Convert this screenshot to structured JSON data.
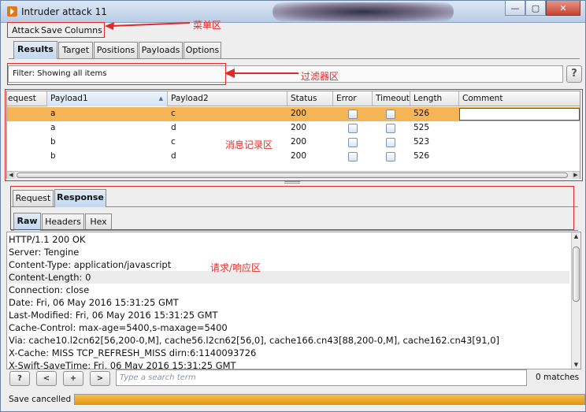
{
  "window": {
    "title": "Intruder attack 11",
    "controls": {
      "minimize": "—",
      "maximize": "▢",
      "close": "✕"
    }
  },
  "menu": {
    "items": [
      "Attack",
      "Save",
      "Columns"
    ]
  },
  "tabs": [
    "Results",
    "Target",
    "Positions",
    "Payloads",
    "Options"
  ],
  "active_tab": "Results",
  "filter": {
    "text": "Filter: Showing all items",
    "help": "?"
  },
  "table": {
    "columns": [
      "equest",
      "Payload1",
      "Payload2",
      "Status",
      "Error",
      "Timeout",
      "Length",
      "Comment"
    ],
    "sorted_column": "Payload1",
    "rows": [
      {
        "payload1": "a",
        "payload2": "c",
        "status": "200",
        "error": false,
        "timeout": false,
        "length": "526",
        "selected": true
      },
      {
        "payload1": "a",
        "payload2": "d",
        "status": "200",
        "error": false,
        "timeout": false,
        "length": "525",
        "selected": false
      },
      {
        "payload1": "b",
        "payload2": "c",
        "status": "200",
        "error": false,
        "timeout": false,
        "length": "523",
        "selected": false
      },
      {
        "payload1": "b",
        "payload2": "d",
        "status": "200",
        "error": false,
        "timeout": false,
        "length": "526",
        "selected": false
      }
    ],
    "selection_color": "#f5b556"
  },
  "request_response_tabs": [
    "Request",
    "Response"
  ],
  "active_rr_tab": "Response",
  "view_tabs": [
    "Raw",
    "Headers",
    "Hex"
  ],
  "active_view_tab": "Raw",
  "response_lines": [
    "HTTP/1.1 200 OK",
    "Server: Tengine",
    "Content-Type: application/javascript",
    "Content-Length: 0",
    "Connection: close",
    "Date: Fri, 06 May 2016 15:31:25 GMT",
    "Last-Modified: Fri, 06 May 2016 15:31:25 GMT",
    "Cache-Control: max-age=5400,s-maxage=5400",
    "Via: cache10.l2cn62[56,200-0,M], cache56.l2cn62[56,0], cache166.cn43[88,200-0,M], cache162.cn43[91,0]",
    "X-Cache: MISS TCP_REFRESH_MISS dirn:6:1140093726",
    "X-Swift-SaveTime: Fri, 06 May 2016 15:31:25 GMT"
  ],
  "highlighted_line": 3,
  "search": {
    "buttons": [
      "?",
      "<",
      "+",
      ">"
    ],
    "placeholder": "Type a search term",
    "matches": "0 matches"
  },
  "status": {
    "text": "Save cancelled",
    "progress": 1.0,
    "progress_color": "#e59a12"
  },
  "annotations": {
    "menu_label": "菜单区",
    "filter_label": "过滤器区",
    "records_label": "消息记录区",
    "reqresp_label": "请求/响应区",
    "color": "#e02a2a"
  }
}
